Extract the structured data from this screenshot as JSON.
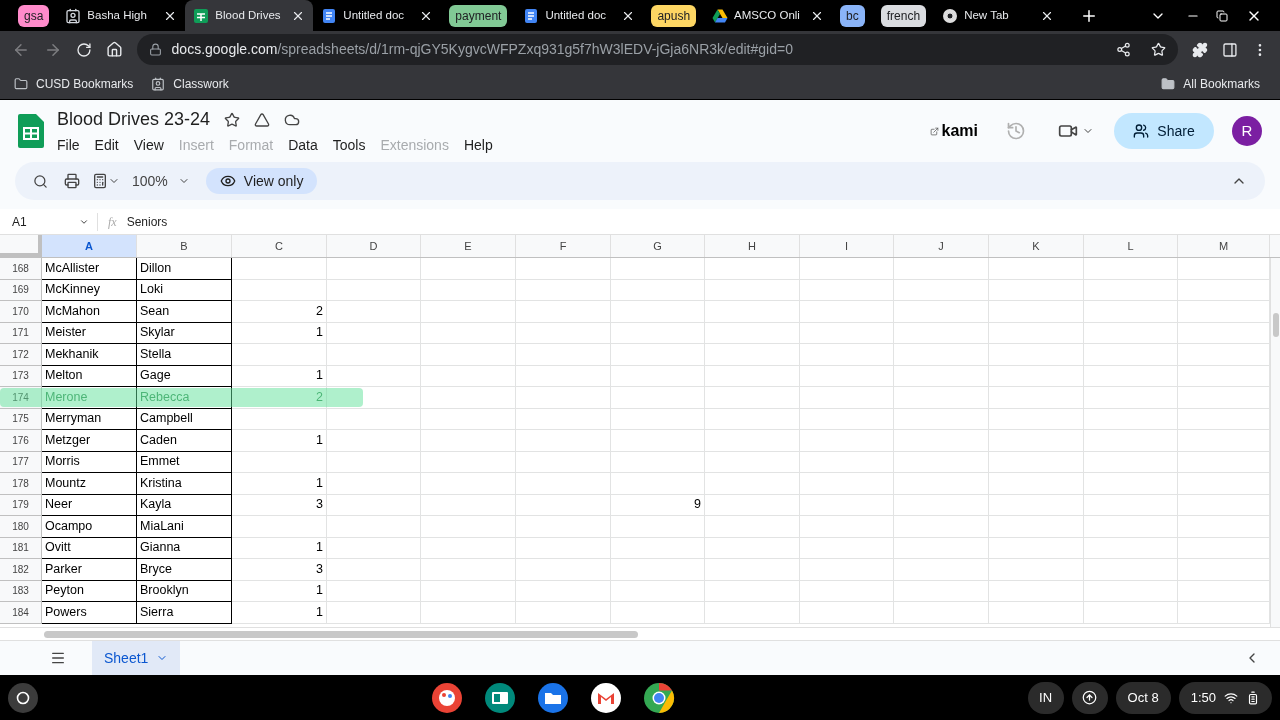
{
  "browser": {
    "tabs": [
      {
        "kind": "group",
        "label": "gsa",
        "color": "#ff8bcb"
      },
      {
        "kind": "tab",
        "title": "Basha High",
        "selected": false
      },
      {
        "kind": "tab",
        "title": "Blood Drives",
        "selected": true
      },
      {
        "kind": "tab",
        "title": "Untitled doc",
        "selected": false
      },
      {
        "kind": "group",
        "label": "payment",
        "color": "#81c995"
      },
      {
        "kind": "tab",
        "title": "Untitled doc",
        "selected": false
      },
      {
        "kind": "group",
        "label": "apush",
        "color": "#fdd663"
      },
      {
        "kind": "tab",
        "title": "AMSCO Onli",
        "selected": false
      },
      {
        "kind": "group",
        "label": "bc",
        "color": "#8ab4f8"
      },
      {
        "kind": "group",
        "label": "french",
        "color": "#dadce0"
      },
      {
        "kind": "tab",
        "title": "New Tab",
        "selected": false
      }
    ],
    "url_domain": "docs.google.com",
    "url_path": "/spreadsheets/d/1rm-qjGY5KygvcWFPZxq931g5f7hW3lEDV-jGja6NR3k/edit#gid=0",
    "bookmarks": [
      "CUSD Bookmarks",
      "Classwork"
    ],
    "all_bookmarks": "All Bookmarks"
  },
  "doc": {
    "title": "Blood Drives 23-24",
    "menu": [
      {
        "label": "File",
        "disabled": false
      },
      {
        "label": "Edit",
        "disabled": false
      },
      {
        "label": "View",
        "disabled": false
      },
      {
        "label": "Insert",
        "disabled": true
      },
      {
        "label": "Format",
        "disabled": true
      },
      {
        "label": "Data",
        "disabled": false
      },
      {
        "label": "Tools",
        "disabled": false
      },
      {
        "label": "Extensions",
        "disabled": true
      },
      {
        "label": "Help",
        "disabled": false
      }
    ],
    "kami": "kami",
    "share": "Share",
    "avatar": "R",
    "zoom": "100%",
    "mode": "View only"
  },
  "formula_bar": {
    "cell": "A1",
    "function_symbol": "fx",
    "value": "Seniors"
  },
  "columns": [
    {
      "label": "A",
      "selected": true
    },
    {
      "label": "B",
      "selected": false
    },
    {
      "label": "C",
      "selected": false
    },
    {
      "label": "D",
      "selected": false
    },
    {
      "label": "E",
      "selected": false
    },
    {
      "label": "F",
      "selected": false
    },
    {
      "label": "G",
      "selected": false
    },
    {
      "label": "H",
      "selected": false
    },
    {
      "label": "I",
      "selected": false
    },
    {
      "label": "J",
      "selected": false
    },
    {
      "label": "K",
      "selected": false
    },
    {
      "label": "L",
      "selected": false
    },
    {
      "label": "M",
      "selected": false
    }
  ],
  "rows": [
    {
      "number": "168",
      "a": "McAllister",
      "b": "Dillon",
      "highlighted": false
    },
    {
      "number": "169",
      "a": "McKinney",
      "b": "Loki",
      "highlighted": false
    },
    {
      "number": "170",
      "a": "McMahon",
      "b": "Sean",
      "c": "2",
      "highlighted": false
    },
    {
      "number": "171",
      "a": "Meister",
      "b": "Skylar",
      "c": "1",
      "highlighted": false
    },
    {
      "number": "172",
      "a": "Mekhanik",
      "b": "Stella",
      "highlighted": false
    },
    {
      "number": "173",
      "a": "Melton",
      "b": "Gage",
      "c": "1",
      "highlighted": false
    },
    {
      "number": "174",
      "a": "Merone",
      "b": "Rebecca",
      "c": "2",
      "highlighted": true
    },
    {
      "number": "175",
      "a": "Merryman",
      "b": "Campbell",
      "highlighted": false
    },
    {
      "number": "176",
      "a": "Metzger",
      "b": "Caden",
      "c": "1",
      "highlighted": false
    },
    {
      "number": "177",
      "a": "Morris",
      "b": "Emmet",
      "highlighted": false
    },
    {
      "number": "178",
      "a": "Mountz",
      "b": "Kristina",
      "c": "1",
      "highlighted": false
    },
    {
      "number": "179",
      "a": "Neer",
      "b": "Kayla",
      "c": "3",
      "g": "9",
      "highlighted": false
    },
    {
      "number": "180",
      "a": "Ocampo",
      "b": "MiaLani",
      "highlighted": false
    },
    {
      "number": "181",
      "a": "Ovitt",
      "b": "Gianna",
      "c": "1",
      "highlighted": false
    },
    {
      "number": "182",
      "a": "Parker",
      "b": "Bryce",
      "c": "3",
      "highlighted": false
    },
    {
      "number": "183",
      "a": "Peyton",
      "b": "Brooklyn",
      "c": "1",
      "highlighted": false
    },
    {
      "number": "184",
      "a": "Powers",
      "b": "Sierra",
      "c": "1",
      "highlighted": false
    }
  ],
  "sheets": [
    {
      "label": "Sheet1",
      "selected": true
    }
  ],
  "taskbar": {
    "ime": "IN",
    "date": "Oct 8",
    "time": "1:50"
  }
}
